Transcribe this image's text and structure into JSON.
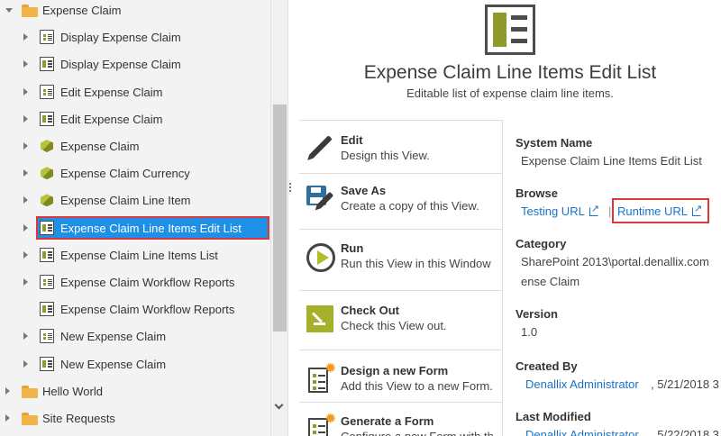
{
  "tree": {
    "nodes": [
      {
        "label": "Expense Claim",
        "icon": "folder-icon",
        "expand": "down",
        "level": 1
      },
      {
        "label": "Display Expense Claim",
        "icon": "form-icon",
        "expand": "right",
        "level": 2
      },
      {
        "label": "Display Expense Claim",
        "icon": "view-icon",
        "expand": "right",
        "level": 2
      },
      {
        "label": "Edit Expense Claim",
        "icon": "form-icon",
        "expand": "right",
        "level": 2
      },
      {
        "label": "Edit Expense Claim",
        "icon": "view-icon",
        "expand": "right",
        "level": 2
      },
      {
        "label": "Expense Claim",
        "icon": "smartobject-icon",
        "expand": "right",
        "level": 2
      },
      {
        "label": "Expense Claim Currency",
        "icon": "smartobject-icon",
        "expand": "right",
        "level": 2
      },
      {
        "label": "Expense Claim Line Item",
        "icon": "smartobject-icon",
        "expand": "right",
        "level": 2
      },
      {
        "label": "Expense Claim Line Items Edit List",
        "icon": "view-icon",
        "expand": "right",
        "level": 2,
        "selected": true
      },
      {
        "label": "Expense Claim Line Items List",
        "icon": "view-icon",
        "expand": "right",
        "level": 2
      },
      {
        "label": "Expense Claim Workflow Reports",
        "icon": "form-icon",
        "expand": "right",
        "level": 2
      },
      {
        "label": "Expense Claim Workflow Reports",
        "icon": "view-icon",
        "expand": "none",
        "level": 2
      },
      {
        "label": "New Expense Claim",
        "icon": "form-icon",
        "expand": "right",
        "level": 2
      },
      {
        "label": "New Expense Claim",
        "icon": "view-icon",
        "expand": "right",
        "level": 2
      },
      {
        "label": "Hello World",
        "icon": "folder-icon",
        "expand": "right",
        "level": 1
      },
      {
        "label": "Site Requests",
        "icon": "folder-icon",
        "expand": "right",
        "level": 1
      }
    ]
  },
  "view": {
    "title": "Expense Claim Line Items Edit List",
    "description": "Editable list of expense claim line items."
  },
  "actions": [
    {
      "title": "Edit",
      "desc": "Design this View.",
      "icon": "pencil-icon"
    },
    {
      "title": "Save As",
      "desc": "Create a copy of this View.",
      "icon": "save-as-icon"
    },
    {
      "title": "Run",
      "desc": "Run this View in this Window",
      "icon": "run-icon"
    },
    {
      "title": "Check Out",
      "desc": "Check this View out.",
      "icon": "check-out-icon"
    },
    {
      "title": "Design a new Form",
      "desc": "Add this View to a new Form.",
      "icon": "design-form-icon"
    },
    {
      "title": "Generate a Form",
      "desc": "Configure a new Form with th",
      "icon": "generate-form-icon"
    }
  ],
  "details": {
    "system_name_label": "System Name",
    "system_name": "Expense Claim Line Items Edit List",
    "browse_label": "Browse",
    "testing_url": "Testing URL",
    "separator": "|",
    "runtime_url": "Runtime URL",
    "category_label": "Category",
    "category_line1": "SharePoint 2013\\portal.denallix.com",
    "category_line2": "ense Claim",
    "version_label": "Version",
    "version": "1.0",
    "created_by_label": "Created By",
    "created_by": "Denallix Administrator",
    "created_date": ", 5/21/2018 3",
    "last_modified_label": "Last Modified",
    "modified_by": "Denallix Administrator",
    "modified_date": ", 5/22/2018 3"
  }
}
